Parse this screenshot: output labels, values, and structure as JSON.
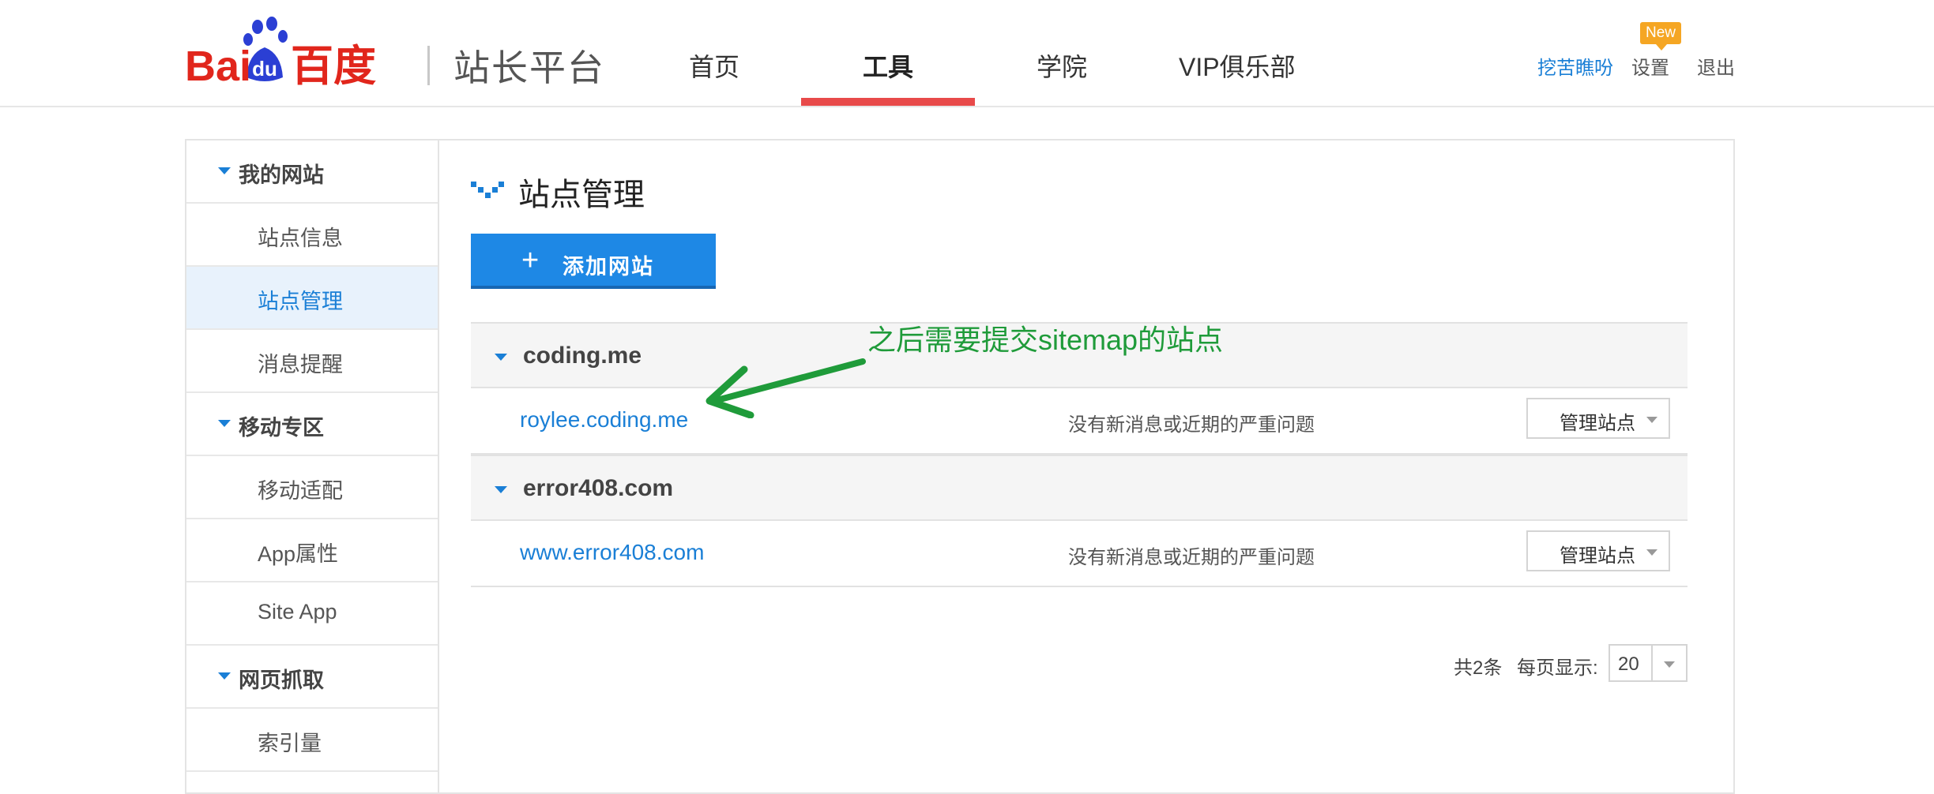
{
  "header": {
    "logo_text": "Bai百度",
    "logo_du": "du",
    "platform": "站长平台",
    "nav": [
      {
        "label": "首页"
      },
      {
        "label": "工具"
      },
      {
        "label": "学院"
      },
      {
        "label": "VIP俱乐部"
      }
    ],
    "active_nav": "工具",
    "user": "挖苦瞧吩",
    "settings": "设置",
    "settings_badge": "New",
    "logout": "退出",
    "colors": {
      "accent": "#e84a4a",
      "link": "#1a7fd6",
      "badge": "#f5a623"
    }
  },
  "sidebar": {
    "sections": [
      {
        "label": "我的网站",
        "items": [
          {
            "label": "站点信息"
          },
          {
            "label": "站点管理"
          },
          {
            "label": "消息提醒"
          }
        ]
      },
      {
        "label": "移动专区",
        "items": [
          {
            "label": "移动适配"
          },
          {
            "label": "App属性"
          },
          {
            "label": "Site App"
          }
        ]
      },
      {
        "label": "网页抓取",
        "items": [
          {
            "label": "索引量"
          }
        ]
      }
    ],
    "active_item": "站点管理"
  },
  "main": {
    "title": "站点管理",
    "add_button": "添加网站",
    "groups": [
      {
        "name": "coding.me",
        "sites": [
          {
            "domain": "roylee.coding.me",
            "status": "没有新消息或近期的严重问题",
            "action": "管理站点"
          }
        ]
      },
      {
        "name": "error408.com",
        "sites": [
          {
            "domain": "www.error408.com",
            "status": "没有新消息或近期的严重问题",
            "action": "管理站点"
          }
        ]
      }
    ],
    "pager": {
      "total": "共2条",
      "per_page_label": "每页显示:",
      "per_page_value": "20"
    }
  },
  "annotation": {
    "text": "之后需要提交sitemap的站点",
    "color": "#1f9b3a"
  }
}
